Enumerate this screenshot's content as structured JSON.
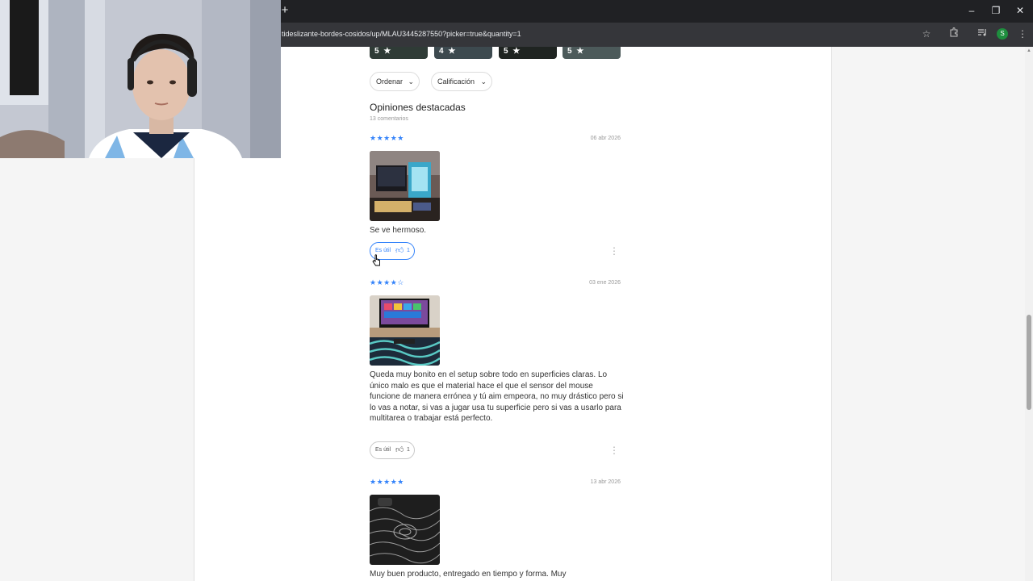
{
  "browser": {
    "url": "tideslizante-bordes-cosidos/up/MLAU3445287550?picker=true&quantity=1",
    "new_tab_symbol": "+",
    "window_controls": [
      "–",
      "❐",
      "✕"
    ],
    "toolbar_icons": [
      "star-icon",
      "extensions-icon",
      "media-icon",
      "profile-icon",
      "menu-icon"
    ],
    "profile_initial": "S"
  },
  "photo_strip": [
    {
      "rating": "5",
      "star": "★"
    },
    {
      "rating": "4",
      "star": "★"
    },
    {
      "rating": "5",
      "star": "★"
    },
    {
      "rating": "5",
      "star": "★"
    }
  ],
  "filters": {
    "sort_label": "Ordenar",
    "rating_label": "Calificación"
  },
  "reviews_section": {
    "title": "Opiniones destacadas",
    "count": "13 comentarios"
  },
  "reviews": [
    {
      "stars": 5,
      "stars_text": "★★★★★",
      "date": "06 abr 2026",
      "text": "Se ve hermoso.",
      "useful_label": "Es útil",
      "useful_count": "1",
      "useful_active": true
    },
    {
      "stars": 4,
      "stars_text": "★★★★☆",
      "date": "03 ene 2026",
      "text": "Queda muy bonito en el setup sobre todo en superficies claras. Lo único malo es que el material hace el que el sensor del mouse funcione de manera errónea y tú aim empeora, no muy drástico pero si lo vas a notar, si vas a jugar usa tu superficie pero si vas a usarlo para multitarea o trabajar está perfecto.",
      "useful_label": "Es útil",
      "useful_count": "1",
      "useful_active": false
    },
    {
      "stars": 5,
      "stars_text": "★★★★★",
      "date": "13 abr 2026",
      "text": "Muy buen producto, entregado en tiempo y forma. Muy",
      "useful_label": "",
      "useful_count": "",
      "useful_active": false
    }
  ],
  "colors": {
    "accent_blue": "#3483fa",
    "chrome_dark": "#202124",
    "side_gray": "#f5f5f5"
  }
}
